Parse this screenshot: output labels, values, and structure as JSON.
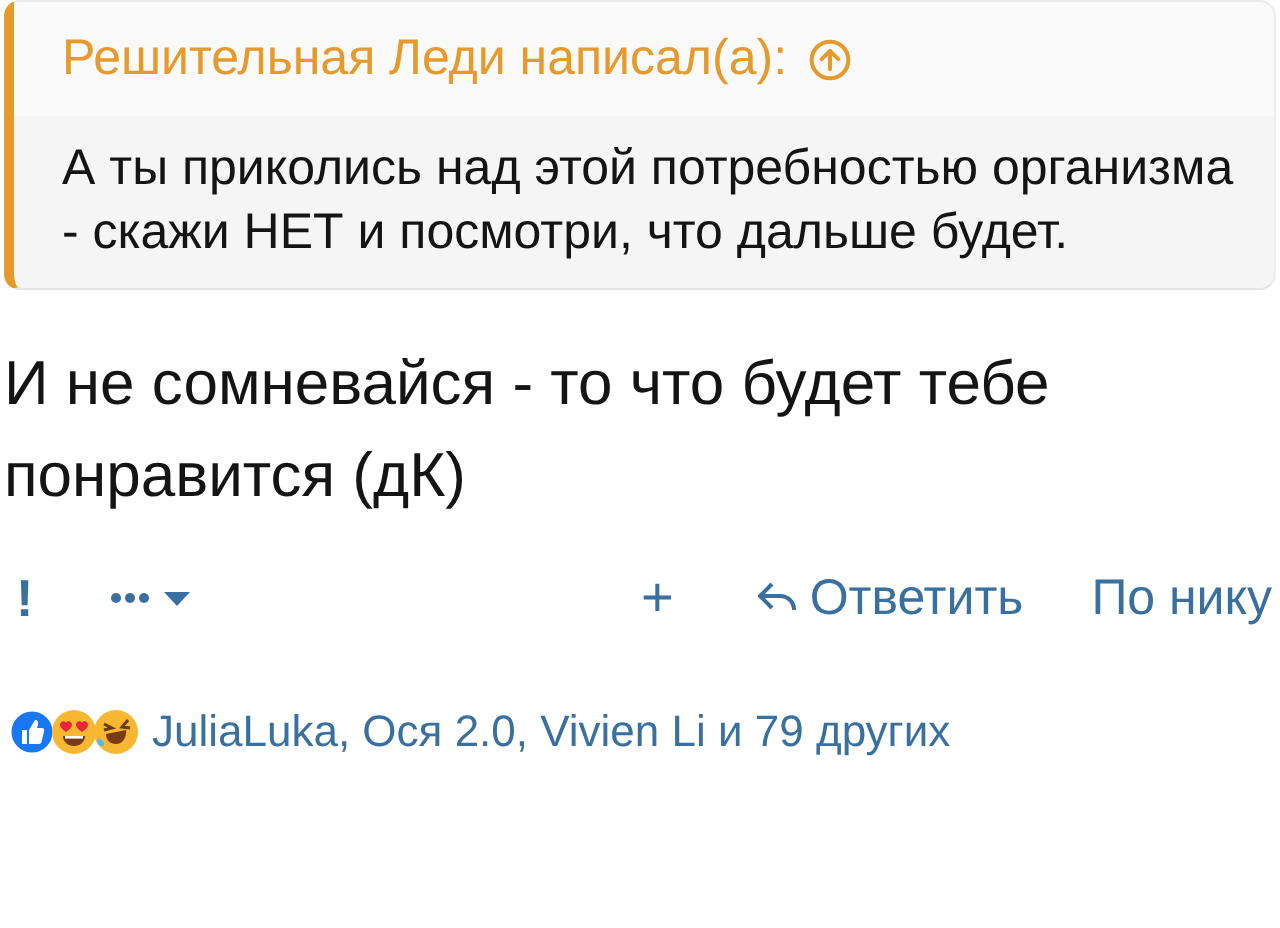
{
  "quote": {
    "author_line": "Решительная Леди написал(а):",
    "text": "А ты приколись над этой потребностью организма - скажи НЕТ и посмотри, что дальше будет."
  },
  "message": "И не сомневайся - то что будет тебе понравится (дК)",
  "actions": [
    {
      "kind": "report",
      "label": "!"
    },
    {
      "kind": "more"
    },
    {
      "kind": "spacer"
    },
    {
      "kind": "add",
      "label": "+"
    },
    {
      "kind": "reply",
      "label": "Ответить"
    },
    {
      "kind": "quote",
      "label": "По нику"
    }
  ],
  "reactions": {
    "text": "JuliaLuka, Ося 2.0, Vivien Li и 79 других"
  }
}
